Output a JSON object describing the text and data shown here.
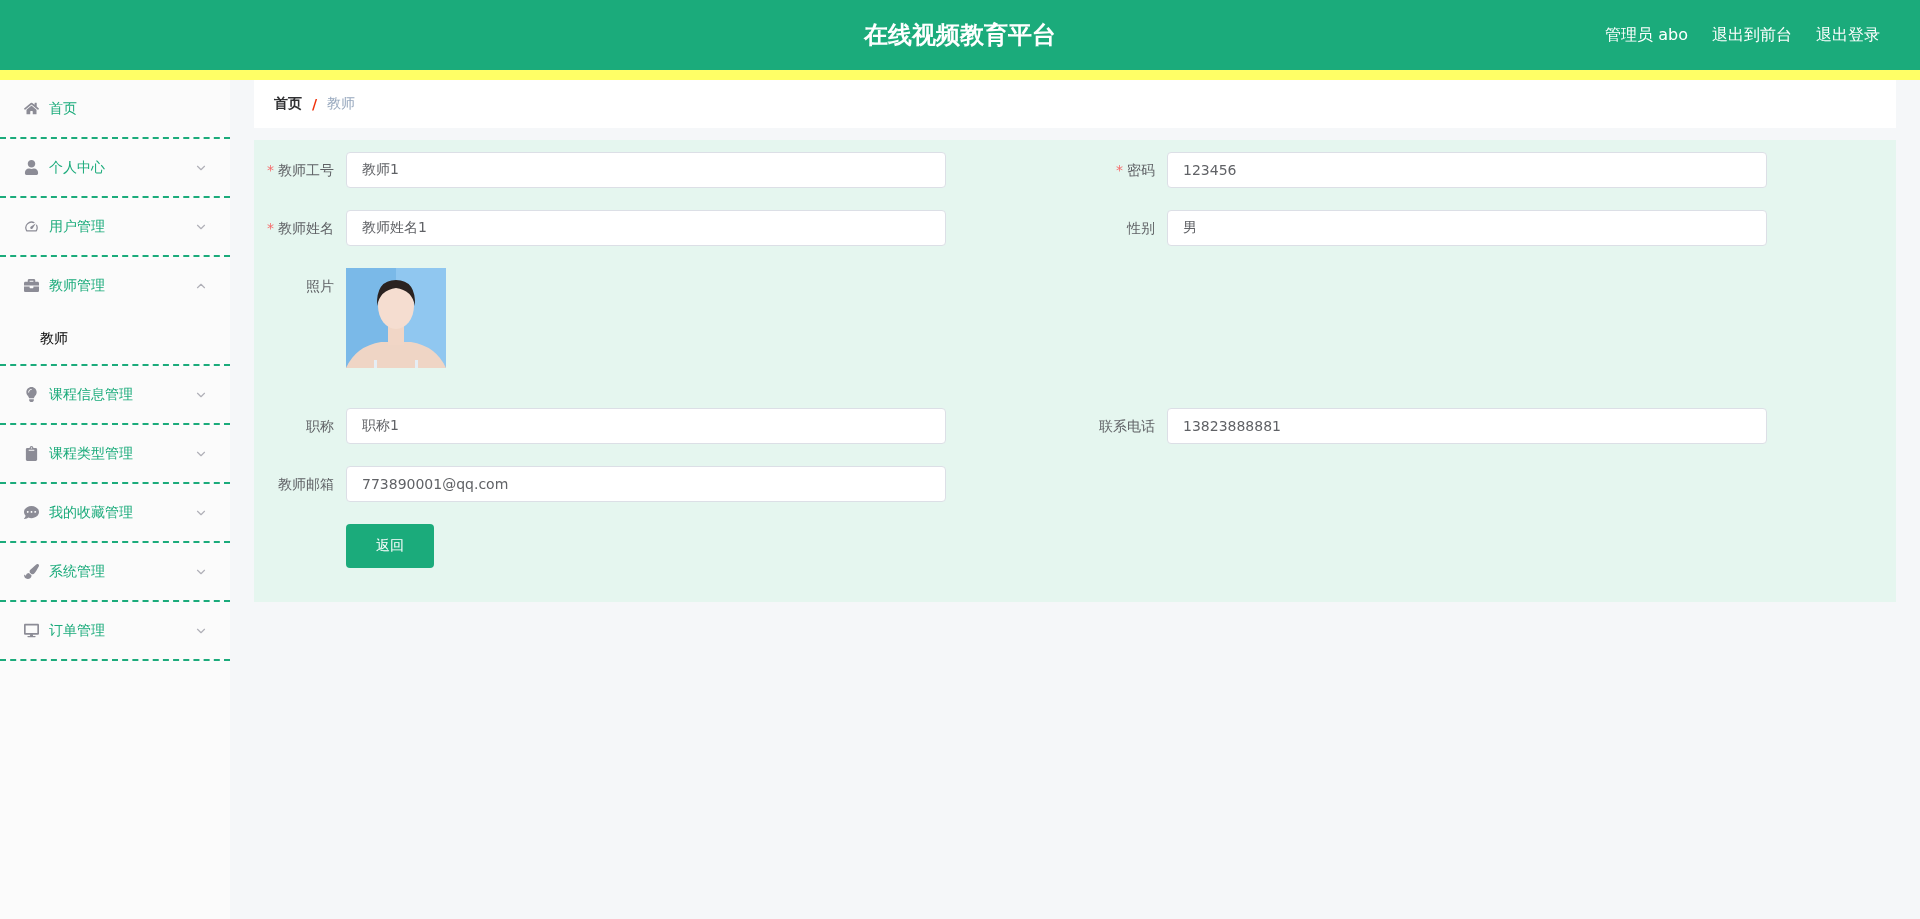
{
  "header": {
    "title": "在线视频教育平台",
    "user": "管理员 abo",
    "links": [
      "退出到前台",
      "退出登录"
    ]
  },
  "sidebar": {
    "items": [
      {
        "label": "首页"
      },
      {
        "label": "个人中心",
        "expanded": false
      },
      {
        "label": "用户管理",
        "expanded": false
      },
      {
        "label": "教师管理",
        "expanded": true,
        "children": [
          {
            "label": "教师",
            "selected": true
          }
        ]
      },
      {
        "label": "课程信息管理",
        "expanded": false
      },
      {
        "label": "课程类型管理",
        "expanded": false
      },
      {
        "label": "我的收藏管理",
        "expanded": false
      },
      {
        "label": "系统管理",
        "expanded": false
      },
      {
        "label": "订单管理",
        "expanded": false
      }
    ]
  },
  "breadcrumb": {
    "home": "首页",
    "separator": "/",
    "current": "教师"
  },
  "form": {
    "rows": [
      [
        {
          "kind": "input",
          "label": "教师工号",
          "required_mark": "*",
          "value": "教师1"
        },
        {
          "kind": "input",
          "label": "密码",
          "required_mark": "*",
          "value": "123456"
        }
      ],
      [
        {
          "kind": "input",
          "label": "教师姓名",
          "required_mark": "*",
          "value": "教师姓名1"
        },
        {
          "kind": "input",
          "label": "性别",
          "value": "男"
        }
      ],
      [
        {
          "kind": "picture",
          "label": "照片"
        }
      ],
      [
        {
          "kind": "input",
          "label": "职称",
          "value": "职称1"
        },
        {
          "kind": "input",
          "label": "联系电话",
          "value": "13823888881"
        }
      ],
      [
        {
          "kind": "input",
          "label": "教师邮箱",
          "value": "773890001@qq.com"
        }
      ]
    ],
    "button": "返回"
  }
}
